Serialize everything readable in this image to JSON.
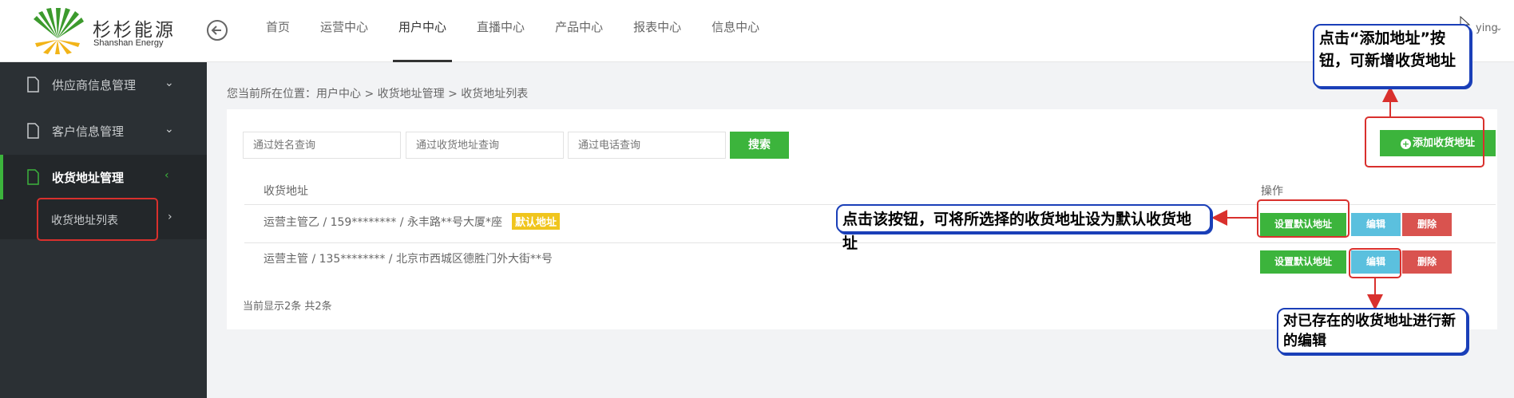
{
  "header": {
    "logo_cn": "杉杉能源",
    "logo_en": "Shanshan Energy",
    "nav": [
      "首页",
      "运营中心",
      "用户中心",
      "直播中心",
      "产品中心",
      "报表中心",
      "信息中心"
    ],
    "active_nav": "用户中心",
    "user_name": "ying"
  },
  "sidebar": {
    "items": [
      {
        "label": "供应商信息管理",
        "chevron": "⌄"
      },
      {
        "label": "客户信息管理",
        "chevron": "⌄"
      },
      {
        "label": "收货地址管理",
        "chevron": "‹"
      }
    ],
    "sub_items": [
      {
        "label": "收货地址列表",
        "chevron": "›"
      }
    ]
  },
  "breadcrumb": "您当前所在位置：用户中心 > 收货地址管理 > 收货地址列表",
  "search": {
    "name_placeholder": "通过姓名查询",
    "address_placeholder": "通过收货地址查询",
    "phone_placeholder": "通过电话查询",
    "button": "搜索"
  },
  "add_button": "添加收货地址",
  "table": {
    "headers": [
      "收货地址",
      "操作"
    ],
    "rows": [
      {
        "address": "运营主管乙 / 159******** / 永丰路**号大厦*座",
        "tag": "默认地址"
      },
      {
        "address": "运营主管 / 135******** / 北京市西城区德胜门外大街**号",
        "tag": ""
      }
    ],
    "ops": {
      "set_default": "设置默认地址",
      "edit": "编辑",
      "delete": "删除"
    }
  },
  "footer": "当前显示2条 共2条",
  "annotations": {
    "add_note": "点击“添加地址”按钮，可新增收货地址",
    "default_note": "点击该按钮，可将所选择的收货地址设为默认收货地址",
    "edit_note": "对已存在的收货地址进行新的编辑"
  },
  "colors": {
    "green": "#3cb43c",
    "blue": "#5bc0de",
    "red": "#d9534f",
    "tag_yellow": "#f0c51d",
    "sidebar": "#2b3034",
    "annotation_red": "#d9302d",
    "callout_blue": "#1a3fb8"
  }
}
